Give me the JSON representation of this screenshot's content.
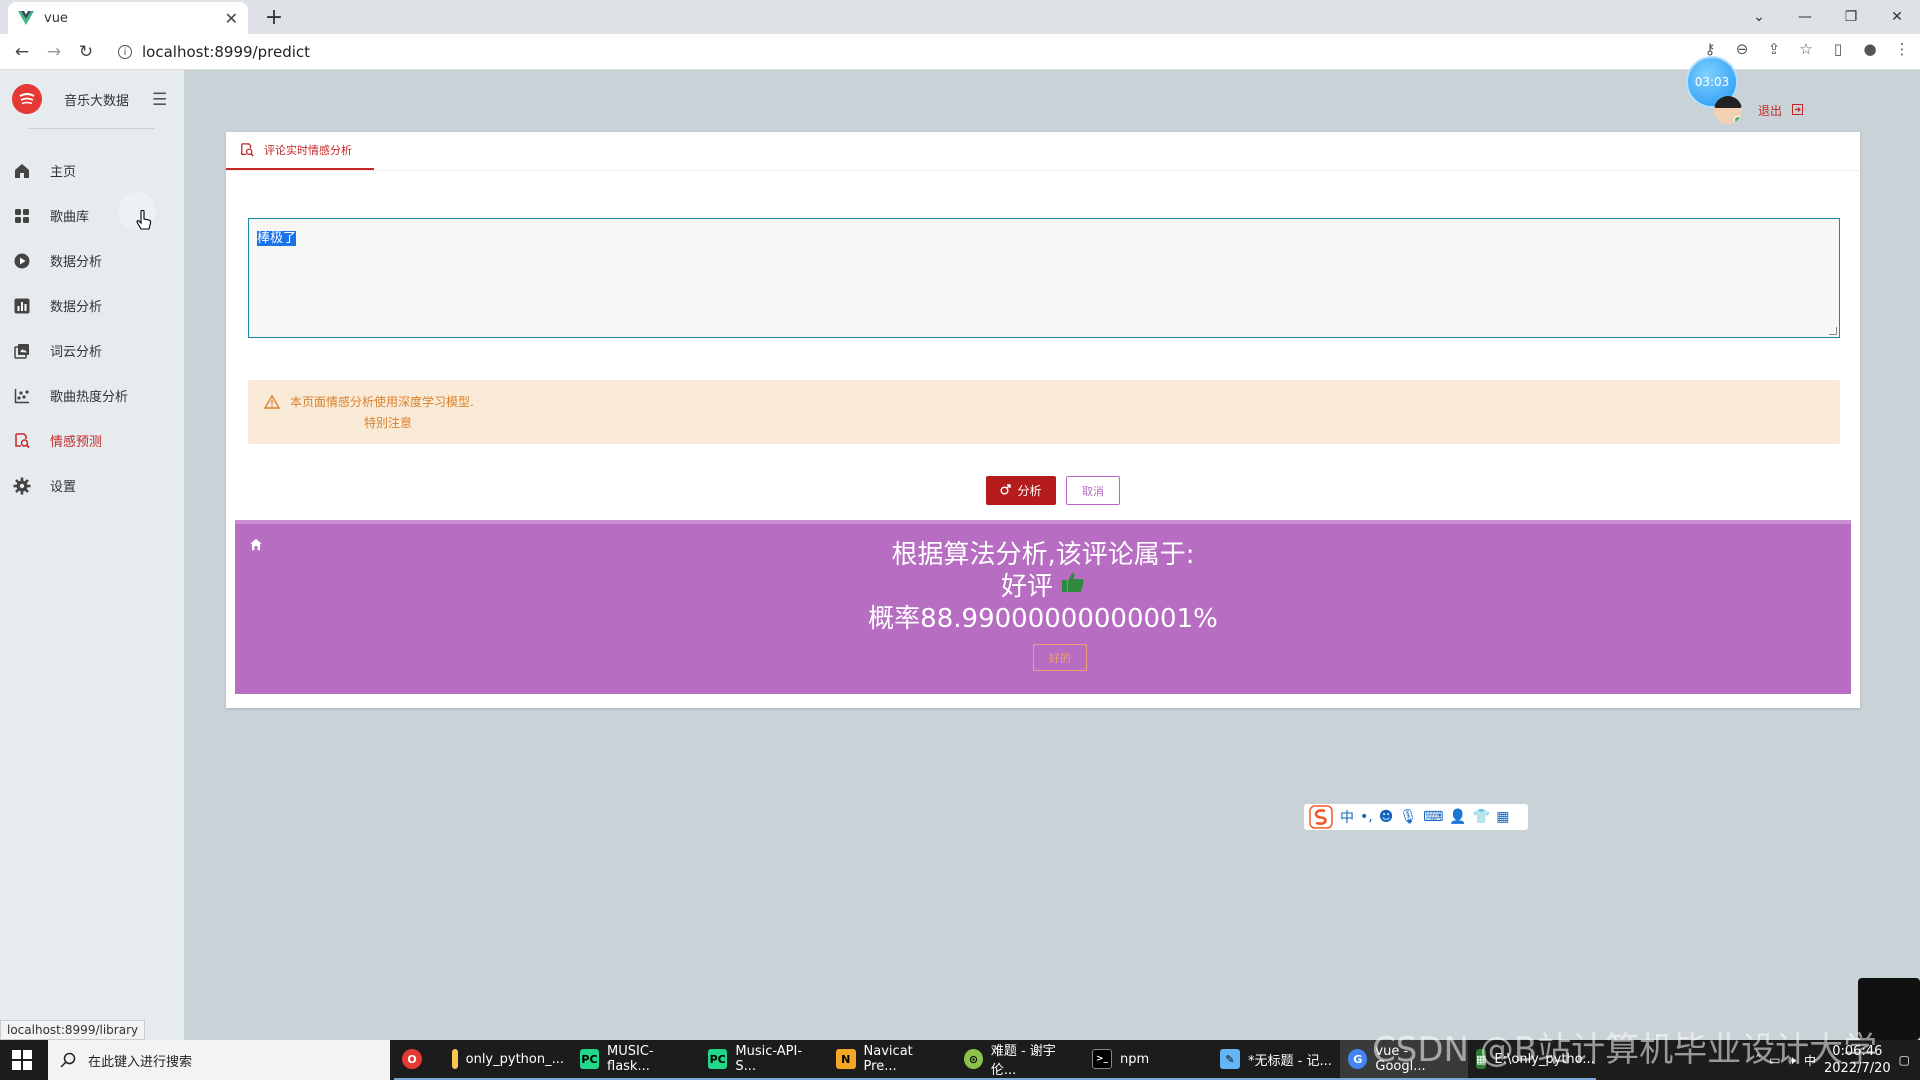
{
  "browser": {
    "tab_title": "vue",
    "url": "localhost:8999/predict",
    "status_url": "localhost:8999/library"
  },
  "app": {
    "brand": "音乐大数据",
    "timer": "03:03",
    "logout": "退出"
  },
  "sidebar": {
    "items": [
      {
        "label": "主页",
        "icon": "home-icon"
      },
      {
        "label": "歌曲库",
        "icon": "grid-icon"
      },
      {
        "label": "数据分析",
        "icon": "play-circle-icon"
      },
      {
        "label": "数据分析",
        "icon": "bar-chart-icon"
      },
      {
        "label": "词云分析",
        "icon": "image-stack-icon"
      },
      {
        "label": "歌曲热度分析",
        "icon": "scatter-icon"
      },
      {
        "label": "情感预测",
        "icon": "search-doc-icon",
        "active": true
      },
      {
        "label": "设置",
        "icon": "gear-icon"
      }
    ]
  },
  "main": {
    "tab_label": "评论实时情感分析",
    "comment_text": "棒极了",
    "alert_line1": "本页面情感分析使用深度学习模型.",
    "alert_line2": "特别注意",
    "analyze_button": "分析",
    "cancel_button": "取消",
    "result": {
      "line1": "根据算法分析,该评论属于:",
      "sentiment": "好评",
      "probability": "概率88.99000000000001%",
      "ok_button": "好的"
    }
  },
  "ime": {
    "mode": "中",
    "punct": "•,"
  },
  "taskbar": {
    "search_placeholder": "在此键入进行搜索",
    "apps": [
      {
        "label": "",
        "color": "#e53935",
        "letter": "O"
      },
      {
        "label": "only_python_...",
        "color": "#f9c74f",
        "letter": ""
      },
      {
        "label": "MUSIC-flask...",
        "color": "#21d789",
        "letter": "PC"
      },
      {
        "label": "Music-API-S...",
        "color": "#21d789",
        "letter": "PC"
      },
      {
        "label": "Navicat Pre...",
        "color": "#f5a623",
        "letter": "N"
      },
      {
        "label": "难题 - 谢宇伦...",
        "color": "#8bc34a",
        "letter": "⊙"
      },
      {
        "label": "npm",
        "color": "#000000",
        "letter": ">_"
      },
      {
        "label": "*无标题 - 记...",
        "color": "#64b5f6",
        "letter": "✎"
      },
      {
        "label": "vue - Googl...",
        "color": "#4285f4",
        "letter": "G"
      },
      {
        "label": "E:\\only_pytho...",
        "color": "#2e7d32",
        "letter": "▦"
      }
    ],
    "ime_indicator": "中",
    "time": "0:06:46",
    "date": "2022/7/20"
  },
  "watermark": "CSDN @B站计算机毕业设计大学"
}
